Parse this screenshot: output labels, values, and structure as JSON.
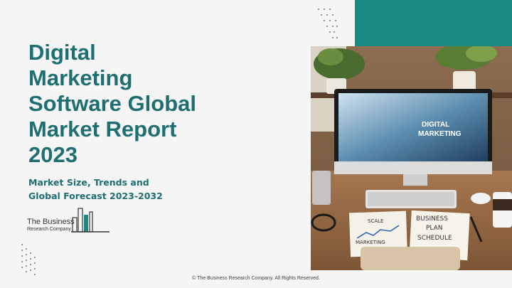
{
  "slide": {
    "title": "Digital\nMarketing\nSoftware Global\nMarket Report\n2023",
    "subtitle": "Market Size, Trends and\nGlobal Forecast 2023-2032",
    "footer": "© The Business Research Company. All Rights Reserved."
  },
  "logo": {
    "line1": "The Business",
    "line2": "Research Company"
  },
  "photo": {
    "screen_text_1": "DIGITAL",
    "screen_text_2": "MARKETING",
    "sign_text_1": "SCALE",
    "sign_text_2": "MARKETING",
    "card_text_1": "BUSINESS",
    "card_text_2": "PLAN",
    "card_text_3": "SCHEDULE"
  },
  "colors": {
    "accent_teal": "#1c8a84",
    "title_teal": "#1f6f72",
    "background": "#f5f5f5"
  }
}
